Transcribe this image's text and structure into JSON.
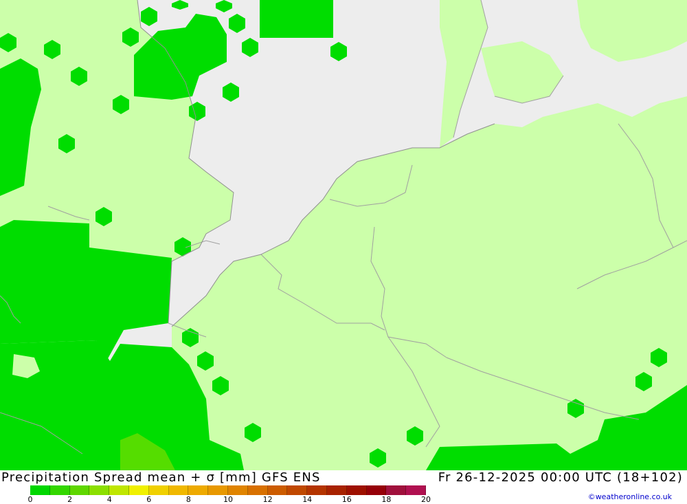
{
  "map": {
    "colors": {
      "sea": "#ededed",
      "land_light": "#ccffaa",
      "green": "#00dd00",
      "green_light": "#55dd00",
      "borders": "#a0a0a0"
    }
  },
  "title": {
    "left": "Precipitation Spread mean + σ [mm] GFS ENS",
    "right": "Fr 26-12-2025 00:00 UTC (18+102)"
  },
  "legend": {
    "colors": [
      "#00d700",
      "#33d700",
      "#5fd700",
      "#8bdf00",
      "#bfe600",
      "#f0f000",
      "#f0d000",
      "#f0b800",
      "#eeaa00",
      "#e89800",
      "#e08400",
      "#d87000",
      "#cc5c00",
      "#c04800",
      "#b43400",
      "#a82200",
      "#9e1000",
      "#960008",
      "#a0103c",
      "#b01050"
    ],
    "ticks": [
      "0",
      "2",
      "4",
      "6",
      "8",
      "10",
      "12",
      "14",
      "16",
      "18",
      "20"
    ]
  },
  "credit": "©weatheronline.co.uk"
}
